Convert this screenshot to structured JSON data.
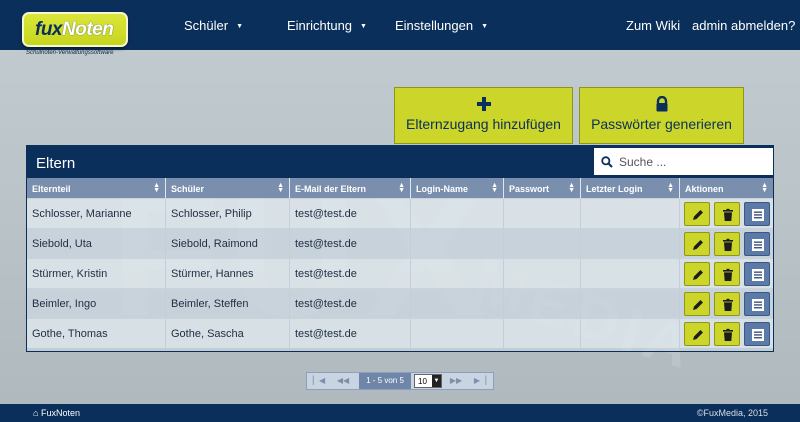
{
  "logo": {
    "name_part1": "fux",
    "name_part2": "Noten",
    "tagline": "Schulnoten-Verwaltungssoftware"
  },
  "nav": {
    "items": [
      {
        "label": "Schüler"
      },
      {
        "label": "Einrichtung"
      },
      {
        "label": "Einstellungen"
      }
    ],
    "wiki_link": "Zum Wiki",
    "logout_link": "admin abmelden?"
  },
  "background_watermark": {
    "line1": "FUX",
    "line2": "MEDIA"
  },
  "actions": {
    "add_parent_access": {
      "label": "Elternzugang hinzufügen",
      "icon": "plus-icon"
    },
    "generate_passwords": {
      "label": "Passwörter generieren",
      "icon": "lock-icon"
    }
  },
  "panel": {
    "title": "Eltern",
    "search_placeholder": "Suche ...",
    "columns": [
      "Elternteil",
      "Schüler",
      "E-Mail der Eltern",
      "Login-Name",
      "Passwort",
      "Letzter Login",
      "Aktionen"
    ],
    "rows": [
      {
        "parent": "Schlosser, Marianne",
        "student": "Schlosser, Philip",
        "email": "test@test.de",
        "login": "",
        "password": "",
        "last_login": ""
      },
      {
        "parent": "Siebold, Uta",
        "student": "Siebold, Raimond",
        "email": "test@test.de",
        "login": "",
        "password": "",
        "last_login": ""
      },
      {
        "parent": "Stürmer, Kristin",
        "student": "Stürmer, Hannes",
        "email": "test@test.de",
        "login": "",
        "password": "",
        "last_login": ""
      },
      {
        "parent": "Beimler, Ingo",
        "student": "Beimler, Steffen",
        "email": "test@test.de",
        "login": "",
        "password": "",
        "last_login": ""
      },
      {
        "parent": "Gothe, Thomas",
        "student": "Gothe, Sascha",
        "email": "test@test.de",
        "login": "",
        "password": "",
        "last_login": ""
      }
    ],
    "row_actions": [
      "edit-pencil-icon",
      "delete-trash-icon",
      "details-list-icon"
    ]
  },
  "pager": {
    "info": "1 - 5 von 5",
    "page_size": "10"
  },
  "footer": {
    "home_label": "FuxNoten",
    "copyright": "©FuxMedia, 2015"
  },
  "colors": {
    "navy": "#0b2f5b",
    "lime": "#ccd52a",
    "header_blue": "#7a8fae",
    "action_blue": "#5c7aa8"
  }
}
